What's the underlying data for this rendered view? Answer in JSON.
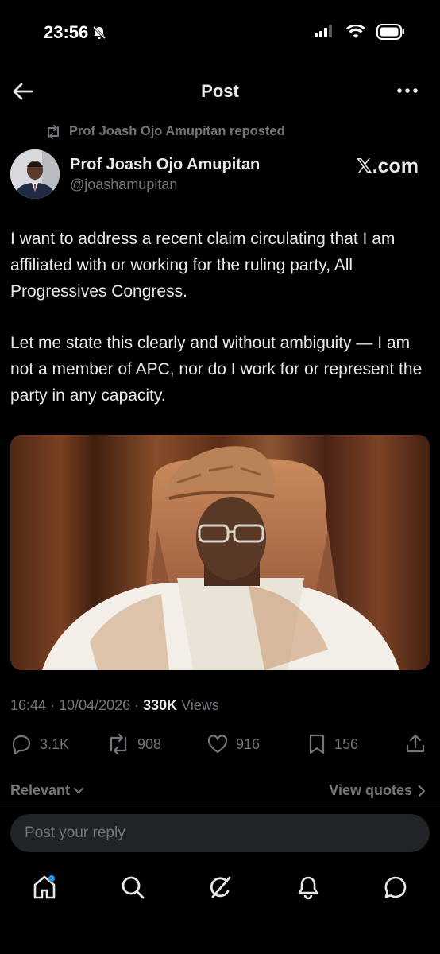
{
  "status_bar": {
    "time": "23:56",
    "icons": [
      "bell-muted-icon",
      "signal-icon",
      "wifi-icon",
      "battery-icon"
    ]
  },
  "header": {
    "title": "Post",
    "icons": [
      "back-arrow-icon",
      "more-icon"
    ]
  },
  "repost": {
    "label": "Prof Joash Ojo Amupitan reposted"
  },
  "author": {
    "name": "Prof Joash Ojo Amupitan",
    "handle": "@joashamupitan",
    "watermark": "𝕏.com"
  },
  "post": {
    "paragraphs": [
      "I want to address a recent claim circulating that I am affiliated with or working for the ruling party, All Progressives Congress.",
      "Let me state this clearly and without ambiguity — I am not a member of APC, nor do I work for or represent the party in any capacity."
    ],
    "timestamp": "16:44 · 10/04/2026 · ",
    "views_count": "330K",
    "views_label": " Views"
  },
  "actions": {
    "replies": "3.1K",
    "reposts": "908",
    "likes": "916",
    "bookmarks": "156"
  },
  "replies_bar": {
    "sort_label": "Relevant",
    "view_quotes": "View quotes"
  },
  "reply_box": {
    "placeholder": "Post your reply"
  },
  "bottom_nav": [
    "home-icon",
    "search-icon",
    "grok-icon",
    "notifications-icon",
    "messages-icon"
  ],
  "colors": {
    "background": "#000000",
    "text": "#e7e9ea",
    "muted": "#71767b",
    "accent": "#1d9bf0",
    "reply_bg": "#202327"
  }
}
